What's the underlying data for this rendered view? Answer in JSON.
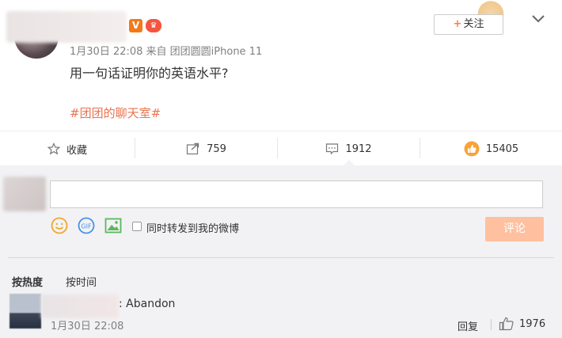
{
  "post": {
    "vip_badge": "V",
    "crown_badge": "♛",
    "meta": "1月30日 22:08 来自 团团圆圆iPhone 11",
    "text": "用一句话证明你的英语水平?",
    "hashtag": "#团团的聊天室#",
    "follow_plus": "+",
    "follow_label": "关注"
  },
  "actions": {
    "favorite": {
      "icon": "star-icon",
      "label": "收藏"
    },
    "repost": {
      "icon": "share-arrow-icon",
      "count": "759"
    },
    "comment": {
      "icon": "comment-bubble-icon",
      "count": "1912"
    },
    "like": {
      "icon": "thumbs-up-icon",
      "count": "15405"
    }
  },
  "composer": {
    "input_value": "",
    "repost_label": "同时转发到我的微博",
    "submit_label": "评论",
    "tools": [
      "emoji-icon",
      "gif-icon",
      "image-icon"
    ]
  },
  "sort": {
    "hot_label": "按热度",
    "time_label": "按时间"
  },
  "comments": [
    {
      "text": ": Abandon",
      "time": "1月30日 22:08",
      "reply_label": "回复",
      "likes": "1976"
    }
  ],
  "colors": {
    "accent": "#eb7350",
    "like_orange": "#f7a33a",
    "submit_disabled": "#ffc09f",
    "comment_bg": "#f2f2f5"
  }
}
